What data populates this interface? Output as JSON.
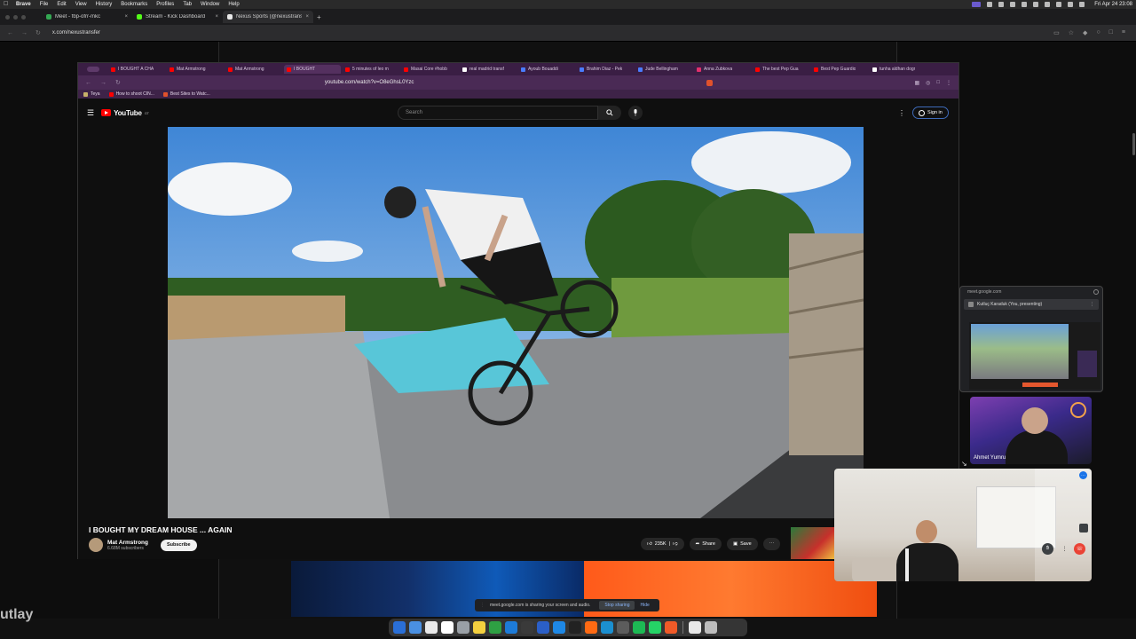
{
  "menubar": {
    "app": "Brave",
    "items": [
      "File",
      "Edit",
      "View",
      "History",
      "Bookmarks",
      "Profiles",
      "Tab",
      "Window",
      "Help"
    ],
    "clock": "Fri Apr 24  23:08"
  },
  "outer_browser": {
    "tabs": [
      {
        "label": "Meet - fbp-ofrr-mkc",
        "color": "#34a853",
        "active": false
      },
      {
        "label": "Stream - Kick Dashboard",
        "color": "#53fc18",
        "active": false
      },
      {
        "label": "Nexus Sports (@nexustransfer)",
        "color": "#e8e8e8",
        "active": true
      }
    ],
    "url": "x.com/nexustransfer"
  },
  "inner_browser": {
    "tabs": [
      {
        "label": "I BOUGHT A CHA",
        "active": false
      },
      {
        "label": "Mat Armstrong",
        "active": false
      },
      {
        "label": "Mat Armstrong",
        "active": false
      },
      {
        "label": "I BOUGHT",
        "active": true
      },
      {
        "label": "5 minutes of leo m",
        "active": false
      },
      {
        "label": "Masai Core #hobb",
        "active": false
      },
      {
        "label": "real madrid transf",
        "active": false
      },
      {
        "label": "Ayoub Bouaddi",
        "active": false
      },
      {
        "label": "Brahim Diaz - Pek",
        "active": false
      },
      {
        "label": "Jude Bellingham",
        "active": false
      },
      {
        "label": "Anna Zubkova",
        "active": false
      },
      {
        "label": "The best Pep Gua",
        "active": false
      },
      {
        "label": "Best Pep Guardio",
        "active": false
      },
      {
        "label": "tunha aldhan dogr",
        "active": false
      }
    ],
    "url": "youtube.com/watch?v=O8eGhsL0Yzc",
    "bookmarks": [
      "Teya",
      "How to shoot CIN...",
      "Best Sites to Watc..."
    ]
  },
  "youtube": {
    "logo": "YouTube",
    "logo_region": "GT",
    "search_placeholder": "Search",
    "sign_in": "Sign in",
    "video_title": "I BOUGHT MY DREAM HOUSE ... AGAIN",
    "channel": "Mat Armstrong",
    "subscribers": "6.68M subscribers",
    "subscribe": "Subscribe",
    "likes": "235K",
    "share": "Share",
    "save": "Save"
  },
  "meet": {
    "panel_url": "meet.google.com",
    "presenter": "Kutluç Karaduk (You, presenting)",
    "participant_name": "Ahmet Yumru",
    "sharing_text": "meet.google.com is sharing your screen and audio.",
    "stop_sharing": "Stop sharing",
    "hide": "Hide"
  },
  "background": {
    "kick_word": "utlay"
  },
  "colors": {
    "inner_theme": "#3a1e44",
    "youtube_red": "#ff0000",
    "hangup": "#ea4335"
  }
}
